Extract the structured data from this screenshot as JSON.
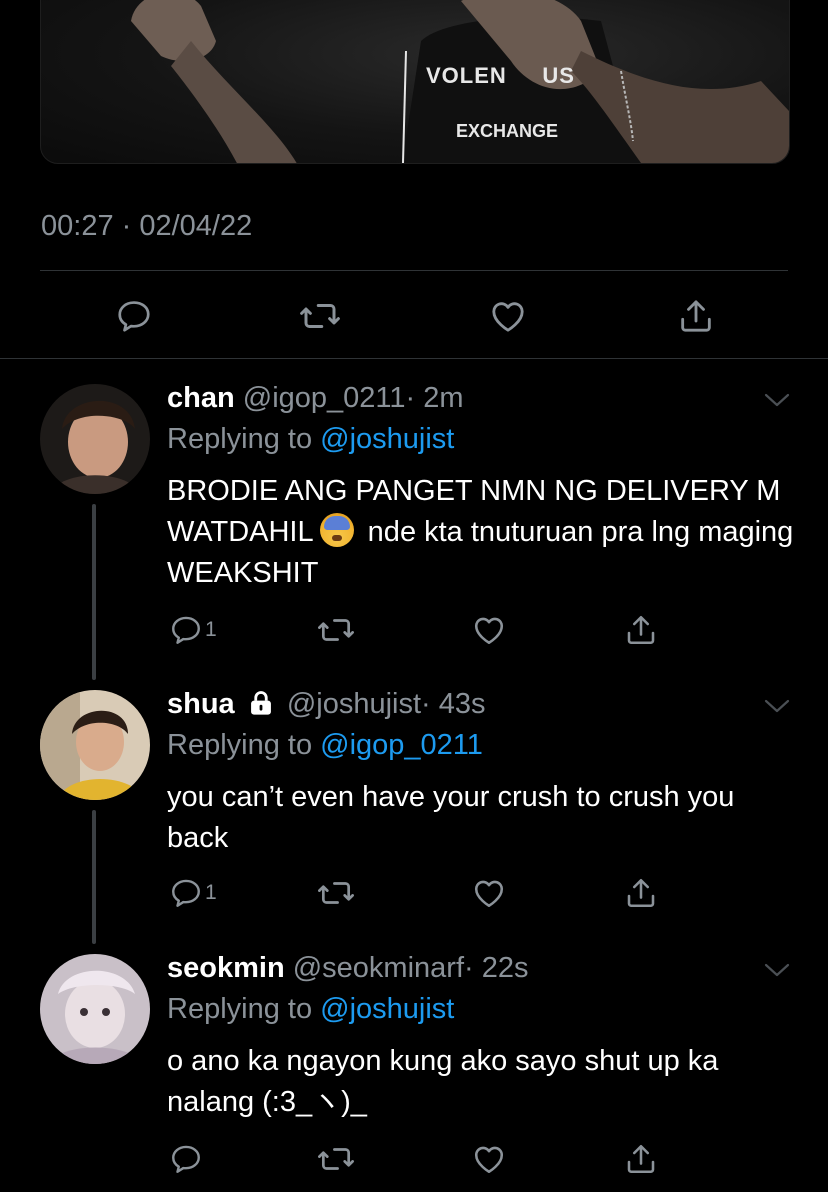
{
  "media": {
    "shirt_lines": [
      "VOLEN     US",
      "EXCHANGE"
    ]
  },
  "tweet": {
    "timestamp": "00:27 · 02/04/22"
  },
  "icons": {
    "reply": "comment-bubble-icon",
    "retweet": "retweet-icon",
    "like": "heart-icon",
    "share": "share-icon",
    "chevron": "chevron-down-icon",
    "lock": "lock-icon"
  },
  "colors": {
    "background": "#000000",
    "muted": "#8b9299",
    "link": "#1d9bf0",
    "divider": "#2f3336"
  },
  "replies": [
    {
      "name": "chan",
      "handle": "@igop_0211",
      "time": "· 2m",
      "replying_prefix": "Replying to ",
      "replying_to": "@joshujist",
      "text_before_emoji": "BRODIE ANG PANGET NMN NG DELIVERY M WATDAHIL",
      "emoji": "anxious-face-with-sweat",
      "text_after_emoji": " nde kta tnuturuan pra lng maging WEAKSHIT",
      "reply_count": "1"
    },
    {
      "name": "shua",
      "handle": "@joshujist",
      "time": "· 43s",
      "replying_prefix": "Replying to ",
      "replying_to": "@igop_0211",
      "text": "you can’t even have your crush to crush you back",
      "reply_count": "1"
    },
    {
      "name": "seokmin",
      "handle": "@seokminarf",
      "time": "· 22s",
      "replying_prefix": "Replying to ",
      "replying_to": "@joshujist",
      "text": "o ano ka ngayon kung ako sayo shut up ka nalang (:3_ヽ)_",
      "reply_count": ""
    }
  ]
}
